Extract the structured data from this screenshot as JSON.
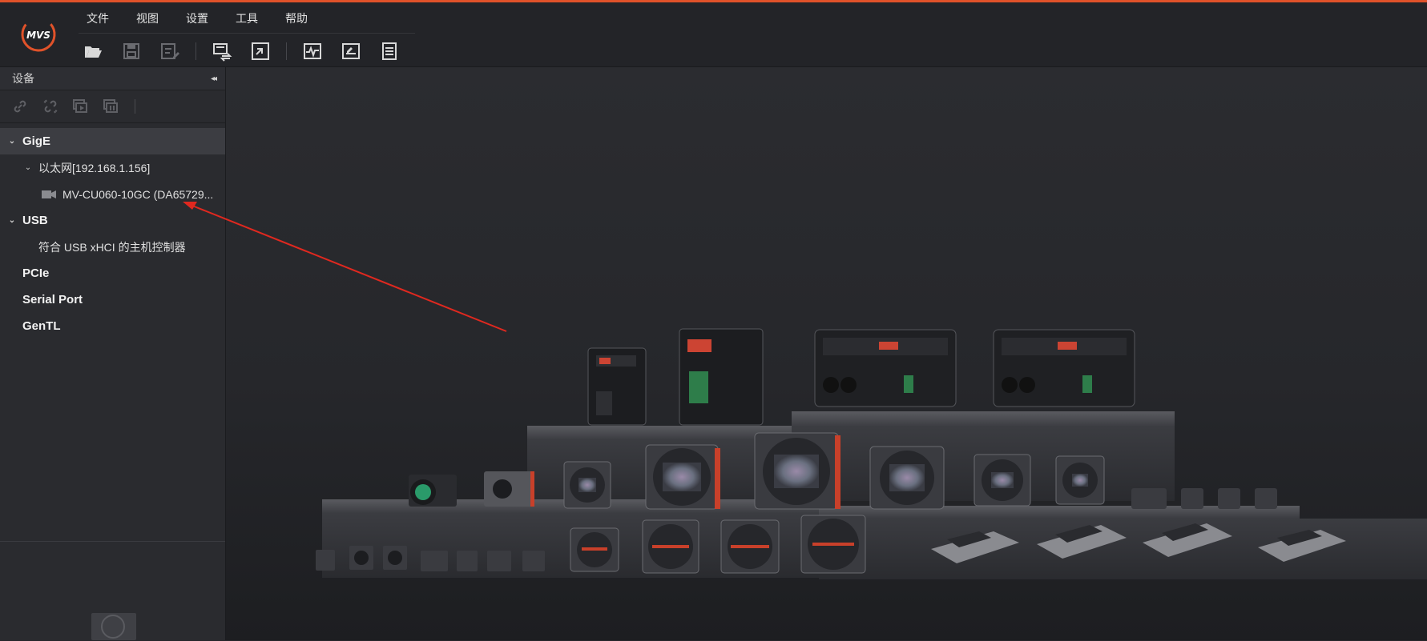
{
  "app": {
    "logo_text": "MVS"
  },
  "colors": {
    "accent": "#e0522a",
    "arrow": "#e0281f"
  },
  "menu": [
    "文件",
    "视图",
    "设置",
    "工具",
    "帮助"
  ],
  "toolbar_icons": [
    "open-folder-icon",
    "save-icon",
    "save-as-icon",
    "device-switch-icon",
    "window-fit-icon",
    "waveform-icon",
    "edit-view-icon",
    "list-icon"
  ],
  "device_panel": {
    "title": "设备",
    "collapse_glyph": "◂◂",
    "tool_icons": [
      "connect-icon",
      "disconnect-icon",
      "start-grab-icon",
      "stop-grab-icon"
    ]
  },
  "tree": {
    "gige": {
      "label": "GigE",
      "chevron": "⌄"
    },
    "ethernet": {
      "label": "以太网[192.168.1.156]",
      "chevron": "⌄"
    },
    "camera": {
      "label": "MV-CU060-10GC (DA65729..."
    },
    "usb": {
      "label": "USB",
      "chevron": "⌄"
    },
    "usb_controller": {
      "label": "符合 USB xHCI 的主机控制器"
    },
    "pcie": {
      "label": "PCIe"
    },
    "serial": {
      "label": "Serial Port"
    },
    "gentl": {
      "label": "GenTL"
    }
  }
}
